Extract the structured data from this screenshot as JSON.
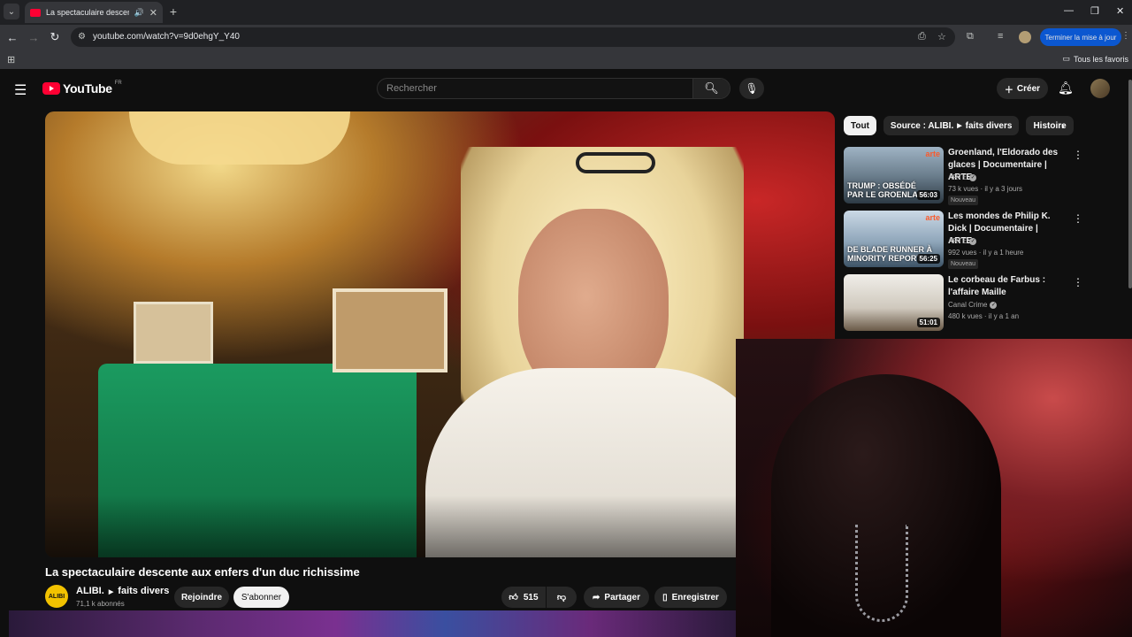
{
  "browser": {
    "tab_title": "La spectaculaire descente a",
    "url": "youtube.com/watch?v=9d0ehgY_Y40",
    "update_button": "Terminer la mise à jour",
    "bookmarks_all": "Tous les favoris"
  },
  "header": {
    "logo": "YouTube",
    "country": "FR",
    "search_placeholder": "Rechercher",
    "create_label": "Créer"
  },
  "video": {
    "title": "La spectaculaire descente aux enfers d'un duc richissime",
    "channel": "ALIBI.",
    "playlist": "faits divers",
    "subscribers": "71,1 k abonnés",
    "avatar_text": "ALIBI",
    "join_label": "Rejoindre",
    "subscribe_label": "S'abonner",
    "likes": "515",
    "share_label": "Partager",
    "save_label": "Enregistrer"
  },
  "chips": {
    "all": "Tout",
    "source": "Source : ALIBI.",
    "source_sub": "faits divers",
    "history": "Histoire"
  },
  "recommendations": [
    {
      "title": "Groenland, l'Eldorado des glaces | Documentaire | ARTE",
      "channel": "ARTE",
      "meta": "73 k vues · il y a 3 jours",
      "badge": "Nouveau",
      "duration": "56:03",
      "caption1": "TRUMP : OBSÉDÉ",
      "caption2": "PAR LE GROENLAND",
      "brand": "arte"
    },
    {
      "title": "Les mondes de Philip K. Dick | Documentaire | ARTE",
      "channel": "ARTE",
      "meta": "992 vues · il y a 1 heure",
      "badge": "Nouveau",
      "duration": "56:25",
      "caption1": "DE BLADE RUNNER À",
      "caption2": "MINORITY REPORT",
      "brand": "arte"
    },
    {
      "title": "Le corbeau de Farbus : l'affaire Maille",
      "channel": "Canal Crime",
      "meta": "480 k vues · il y a 1 an",
      "duration": "51:01"
    }
  ],
  "icons": {
    "menu": "hamburger-icon",
    "search": "search-icon",
    "mic": "mic-icon",
    "bell": "bell-icon",
    "like": "thumbs-up-icon",
    "dislike": "thumbs-down-icon",
    "share": "share-icon",
    "save": "bookmark-icon"
  },
  "colors": {
    "brand_red": "#ff0033",
    "background": "#0f0f0f",
    "update_blue": "#0b57d0"
  }
}
